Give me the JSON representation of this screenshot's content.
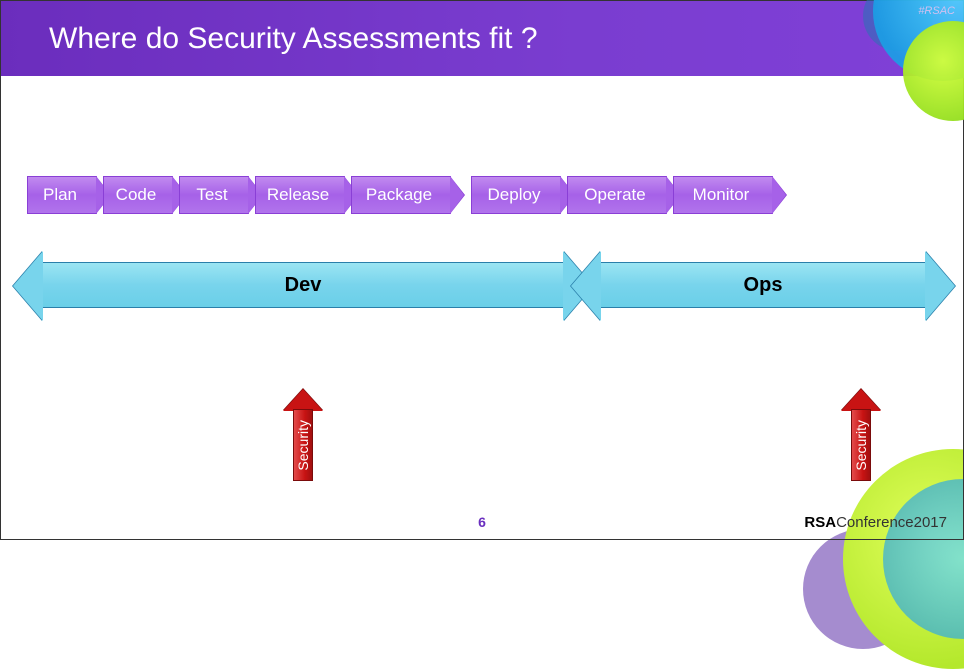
{
  "header": {
    "title": "Where do Security Assessments fit ?",
    "tag": "#RSAC"
  },
  "stages": [
    "Plan",
    "Code",
    "Test",
    "Release",
    "Package",
    "Deploy",
    "Operate",
    "Monitor"
  ],
  "groups": {
    "dev": "Dev",
    "ops": "Ops"
  },
  "security_label": "Security",
  "page_number": "6",
  "conference": {
    "brand": "RSA",
    "rest": "Conference2017"
  }
}
